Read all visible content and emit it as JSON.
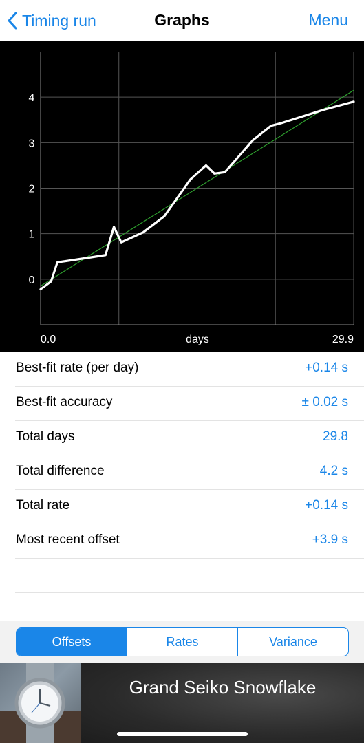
{
  "nav": {
    "back_label": "Timing run",
    "title": "Graphs",
    "menu_label": "Menu"
  },
  "colors": {
    "accent": "#1a86e8",
    "chart_background": "#000000",
    "offset_line": "#ffffff",
    "fit_line": "#2e9e2e",
    "grid": "#555555"
  },
  "chart_data": {
    "type": "line",
    "xlabel": "days",
    "x_tick_labels": [
      "0.0",
      "29.9"
    ],
    "y_ticks": [
      0,
      1,
      2,
      3,
      4
    ],
    "xlim": [
      0,
      29.9
    ],
    "ylim": [
      -1,
      5
    ],
    "grid": true,
    "series": [
      {
        "x": [
          0.0,
          1.0,
          1.6,
          4.5,
          6.2,
          7.0,
          7.7,
          9.8,
          11.8,
          14.3,
          15.8,
          16.6,
          17.6,
          20.3,
          22.0,
          23.0,
          27.0,
          29.9
        ],
        "values": [
          -0.22,
          -0.05,
          0.37,
          0.47,
          0.53,
          1.15,
          0.81,
          1.03,
          1.38,
          2.19,
          2.5,
          2.32,
          2.35,
          3.06,
          3.37,
          3.43,
          3.72,
          3.9
        ]
      },
      {
        "x": [
          0.0,
          29.9
        ],
        "values": [
          -0.15,
          4.15
        ]
      }
    ]
  },
  "stats": [
    {
      "label": "Best-fit rate (per day)",
      "value": "+0.14 s"
    },
    {
      "label": "Best-fit accuracy",
      "value": "± 0.02 s"
    },
    {
      "label": "Total days",
      "value": "29.8"
    },
    {
      "label": "Total difference",
      "value": "4.2 s"
    },
    {
      "label": "Total rate",
      "value": "+0.14 s"
    },
    {
      "label": "Most recent offset",
      "value": "+3.9 s"
    }
  ],
  "segments": {
    "items": [
      "Offsets",
      "Rates",
      "Variance"
    ],
    "selected": "Offsets"
  },
  "banner": {
    "title": "Grand Seiko Snowflake"
  }
}
